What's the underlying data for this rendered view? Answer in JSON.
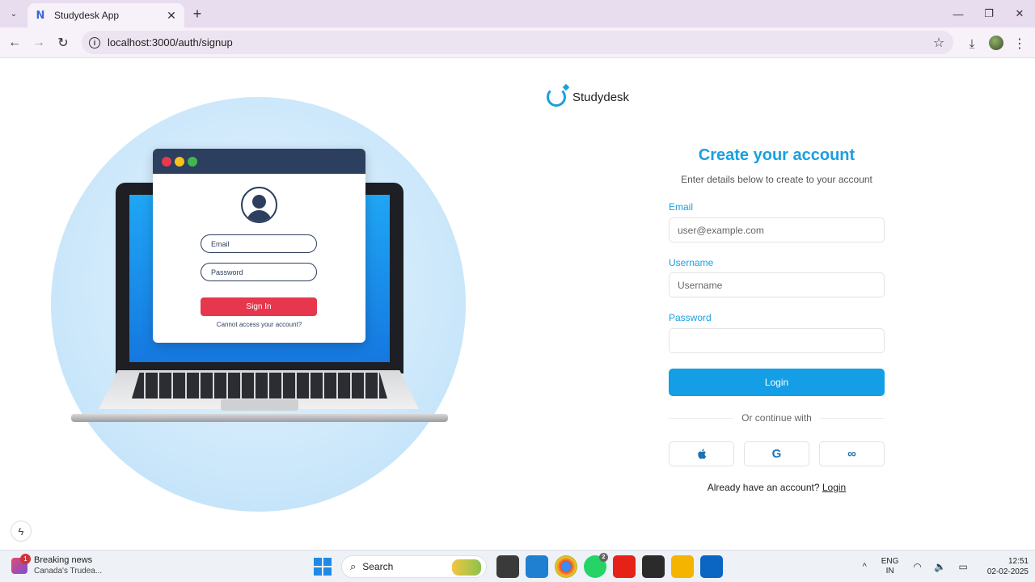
{
  "browser": {
    "tab_title": "Studydesk App",
    "tab_favicon": "N",
    "close_glyph": "✕",
    "new_tab_glyph": "+",
    "url": "localhost:3000/auth/signup",
    "minimize_glyph": "—",
    "maximize_glyph": "❐",
    "close_window_glyph": "✕",
    "back_glyph": "←",
    "forward_glyph": "→",
    "reload_glyph": "↻",
    "info_glyph": "i",
    "star_glyph": "☆",
    "download_glyph": "⤓",
    "menu_glyph": "⋮",
    "tab_search_glyph": "⌄"
  },
  "illustration": {
    "email_placeholder": "Email",
    "password_placeholder": "Password",
    "sign_in_label": "Sign In",
    "cannot_access": "Cannot access your account?"
  },
  "brand": {
    "name": "Studydesk",
    "accent": "#1a9fe0"
  },
  "form": {
    "title": "Create your account",
    "subtitle": "Enter details below to create to your account",
    "email_label": "Email",
    "email_placeholder": "user@example.com",
    "username_label": "Username",
    "username_placeholder": "Username",
    "password_label": "Password",
    "password_value": "",
    "submit_label": "Login",
    "divider_text": "Or continue with",
    "social": [
      {
        "icon": "apple-icon",
        "glyph": ""
      },
      {
        "icon": "google-icon",
        "glyph": "G"
      },
      {
        "icon": "meta-icon",
        "glyph": "∞"
      }
    ],
    "already_text": "Already have an account?",
    "login_link": "Login"
  },
  "floating": {
    "bolt_glyph": "ϟ"
  },
  "taskbar": {
    "news_badge": "1",
    "news_title": "Breaking news",
    "news_sub": "Canada's Trudea...",
    "search_label": "Search",
    "search_glyph": "⌕",
    "whatsapp_badge": "2",
    "tray_up": "^",
    "lang_1": "ENG",
    "lang_2": "IN",
    "tray_icons": "◠ 🔈 ▭",
    "time": "12:51",
    "date": "02-02-2025"
  }
}
